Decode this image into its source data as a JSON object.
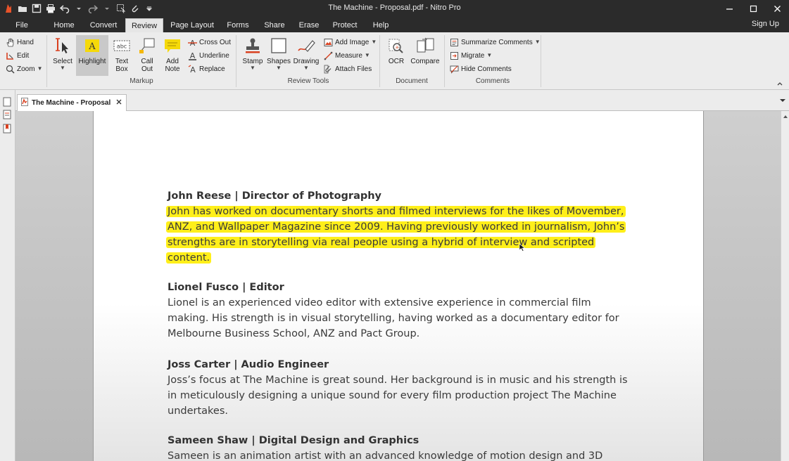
{
  "window": {
    "title": "The Machine - Proposal.pdf - Nitro Pro"
  },
  "menu": {
    "tabs": [
      {
        "label": "File"
      },
      {
        "label": "Home"
      },
      {
        "label": "Convert"
      },
      {
        "label": "Review"
      },
      {
        "label": "Page Layout"
      },
      {
        "label": "Forms"
      },
      {
        "label": "Share"
      },
      {
        "label": "Erase"
      },
      {
        "label": "Protect"
      },
      {
        "label": "Help"
      }
    ],
    "active_tab": "Review",
    "sign_up": "Sign Up"
  },
  "ribbon": {
    "navigate": {
      "hand": "Hand",
      "edit": "Edit",
      "zoom": "Zoom"
    },
    "markup": {
      "label": "Markup",
      "select": "Select",
      "highlight": "Highlight",
      "text_box_1": "Text",
      "text_box_2": "Box",
      "call_out_1": "Call",
      "call_out_2": "Out",
      "add_note_1": "Add",
      "add_note_2": "Note",
      "cross_out": "Cross Out",
      "underline": "Underline",
      "replace": "Replace"
    },
    "review_tools": {
      "label": "Review Tools",
      "stamp": "Stamp",
      "shapes": "Shapes",
      "drawing": "Drawing",
      "add_image": "Add Image",
      "measure": "Measure",
      "attach_files": "Attach Files"
    },
    "document": {
      "label": "Document",
      "ocr": "OCR",
      "compare": "Compare"
    },
    "comments": {
      "label": "Comments",
      "summarize": "Summarize Comments",
      "migrate": "Migrate",
      "hide": "Hide Comments"
    }
  },
  "doc_tab": {
    "label": "The Machine - Proposal"
  },
  "document": {
    "sections": [
      {
        "heading": "John Reese | Director of Photography",
        "highlighted": true,
        "lines": [
          "John has worked on documentary shorts and filmed interviews for the likes of Movember,",
          "ANZ, and Wallpaper Magazine since 2009. Having previously worked in journalism, John’s",
          "strengths are in storytelling via real people using a hybrid of interview and scripted",
          "content."
        ]
      },
      {
        "heading": "Lionel Fusco | Editor",
        "highlighted": false,
        "lines": [
          "Lionel is an experienced video editor with extensive experience in commercial film",
          "making. His strength is in visual storytelling, having worked as a documentary editor for",
          "Melbourne Business School, ANZ and Pact Group."
        ]
      },
      {
        "heading": "Joss Carter | Audio Engineer",
        "highlighted": false,
        "lines": [
          "Joss’s focus at The Machine is great sound. Her background is in music and his strength is",
          "in meticulously designing a unique sound for every film production project The Machine",
          "undertakes."
        ]
      },
      {
        "heading": "Sameen Shaw | Digital Design and Graphics",
        "highlighted": false,
        "lines": [
          "Sameen is an animation artist with an advanced knowledge of motion design and 3D"
        ]
      }
    ]
  },
  "colors": {
    "titlebar": "#2b2b2b",
    "ribbon": "#ececec",
    "highlight": "#ffef1a",
    "accent_red": "#d9401f"
  }
}
